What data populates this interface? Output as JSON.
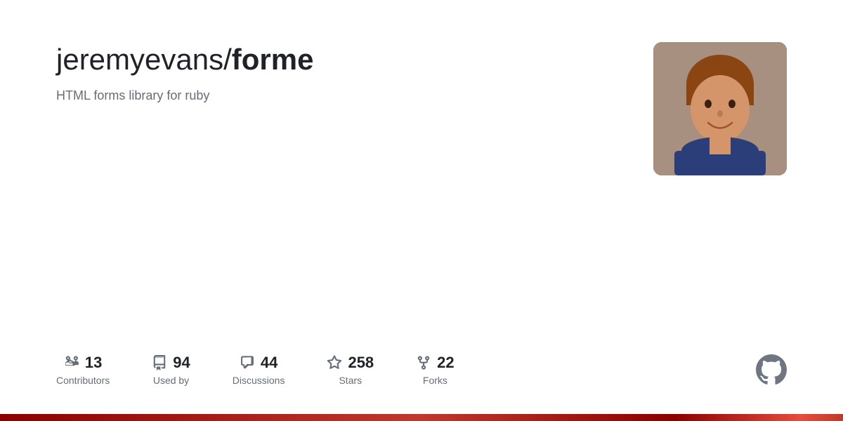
{
  "repo": {
    "owner": "jeremyevans/",
    "name": "forme",
    "description": "HTML forms library for ruby"
  },
  "stats": [
    {
      "id": "contributors",
      "number": "13",
      "label": "Contributors"
    },
    {
      "id": "used-by",
      "number": "94",
      "label": "Used by"
    },
    {
      "id": "discussions",
      "number": "44",
      "label": "Discussions"
    },
    {
      "id": "stars",
      "number": "258",
      "label": "Stars"
    },
    {
      "id": "forks",
      "number": "22",
      "label": "Forks"
    }
  ]
}
